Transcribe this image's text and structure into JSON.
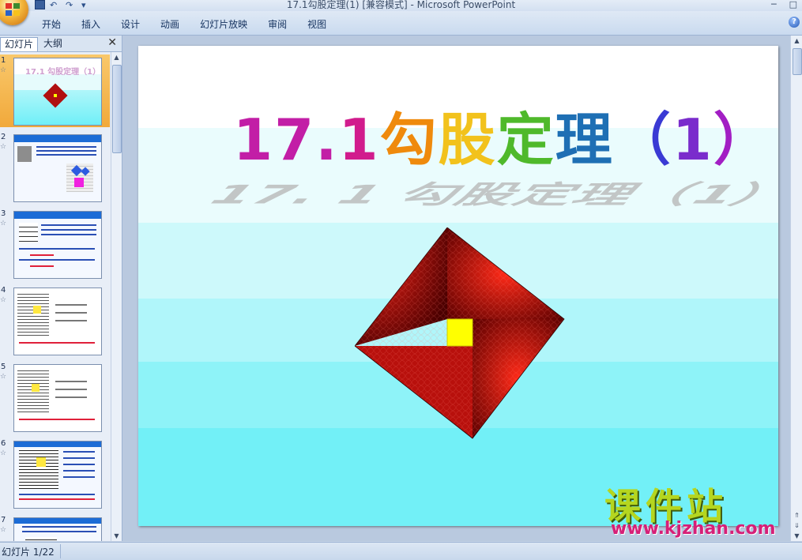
{
  "window": {
    "title": "17.1勾股定理(1) [兼容模式] - Microsoft PowerPoint"
  },
  "ribbon": {
    "tabs": [
      "开始",
      "插入",
      "设计",
      "动画",
      "幻灯片放映",
      "审阅",
      "视图"
    ],
    "help_label": "?"
  },
  "left_panel": {
    "tabs": [
      "幻灯片",
      "大纲"
    ],
    "close_label": "✕",
    "thumbnails": [
      {
        "number": "1",
        "star": "☆"
      },
      {
        "number": "2",
        "star": "☆"
      },
      {
        "number": "3",
        "star": "☆"
      },
      {
        "number": "4",
        "star": "☆"
      },
      {
        "number": "5",
        "star": "☆"
      },
      {
        "number": "6",
        "star": "☆"
      },
      {
        "number": "7",
        "star": "☆"
      }
    ],
    "selected_index": 0
  },
  "slide": {
    "title_chars": [
      {
        "text": "17.",
        "color": "#c21ea6"
      },
      {
        "text": "1",
        "color": "#d11c8d"
      },
      {
        "text": " ",
        "color": "#ffffff"
      },
      {
        "text": "勾",
        "color": "#ef8a0c"
      },
      {
        "text": "股",
        "color": "#f2c21c"
      },
      {
        "text": "定",
        "color": "#4fb92b"
      },
      {
        "text": "理",
        "color": "#1e6fb4"
      },
      {
        "text": "（",
        "color": "#3a3ad4"
      },
      {
        "text": "1",
        "color": "#7a2ccc"
      },
      {
        "text": "）",
        "color": "#a21ec4"
      }
    ],
    "shadow_text": "17. 1 勾股定理（1）",
    "center_square_color": "#ffff00",
    "diamond_color": "#c0120e"
  },
  "watermark": {
    "top": "课件站",
    "bottom": "www.kjzhan.com"
  },
  "status": {
    "slide_info": "幻灯片 1/22"
  }
}
